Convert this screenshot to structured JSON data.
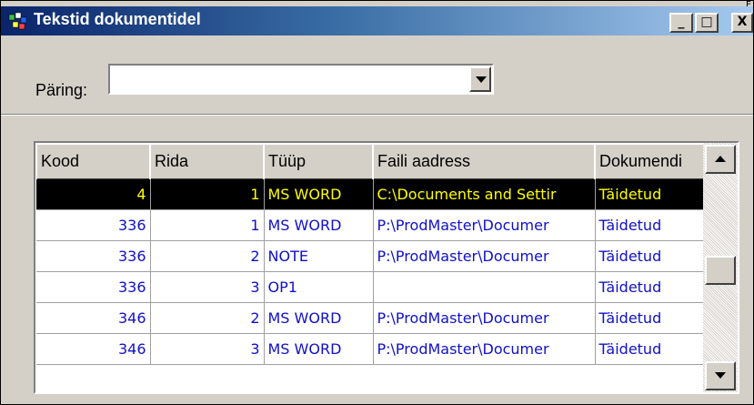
{
  "window": {
    "title": "Tekstid dokumentidel",
    "minimize": "_",
    "maximize": "□",
    "close": "X",
    "corner_glyph": "E"
  },
  "query": {
    "label": "Päring:",
    "value": ""
  },
  "grid": {
    "columns": [
      "Kood",
      "Rida",
      "Tüüp",
      "Faili aadress",
      "Dokumendi"
    ],
    "rows": [
      {
        "kood": "4",
        "rida": "1",
        "tyyp": "MS WORD",
        "fail": "C:\\Documents and Settir",
        "dok": "Täidetud",
        "selected": true
      },
      {
        "kood": "336",
        "rida": "1",
        "tyyp": "MS WORD",
        "fail": "P:\\ProdMaster\\Documer",
        "dok": "Täidetud",
        "selected": false
      },
      {
        "kood": "336",
        "rida": "2",
        "tyyp": "NOTE",
        "fail": "P:\\ProdMaster\\Documer",
        "dok": "Täidetud",
        "selected": false
      },
      {
        "kood": "336",
        "rida": "3",
        "tyyp": "OP1",
        "fail": "",
        "dok": "Täidetud",
        "selected": false
      },
      {
        "kood": "346",
        "rida": "2",
        "tyyp": "MS WORD",
        "fail": "P:\\ProdMaster\\Documer",
        "dok": "Täidetud",
        "selected": false
      },
      {
        "kood": "346",
        "rida": "3",
        "tyyp": "MS WORD",
        "fail": "P:\\ProdMaster\\Documer",
        "dok": "Täidetud",
        "selected": false
      }
    ]
  },
  "colors": {
    "selected_bg": "#000000",
    "selected_fg": "#ffff00",
    "row_fg": "#1010c8",
    "title_bar": "#0a246a"
  }
}
